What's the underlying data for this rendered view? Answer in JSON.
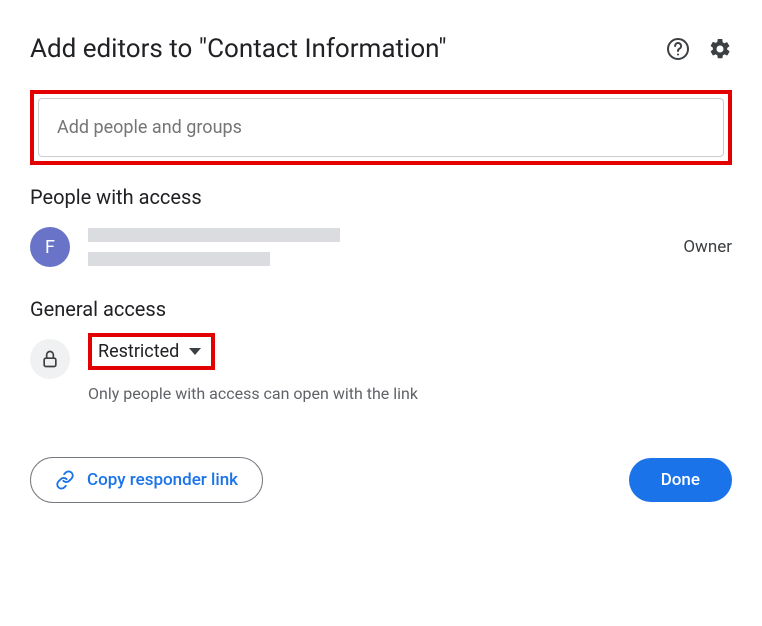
{
  "header": {
    "title": "Add editors to \"Contact Information\""
  },
  "input": {
    "placeholder": "Add people and groups"
  },
  "people_access": {
    "heading": "People with access",
    "person": {
      "avatar_initial": "F",
      "role": "Owner"
    }
  },
  "general_access": {
    "heading": "General access",
    "level": "Restricted",
    "description": "Only people with access can open with the link"
  },
  "footer": {
    "copy_link_label": "Copy responder link",
    "done_label": "Done"
  }
}
